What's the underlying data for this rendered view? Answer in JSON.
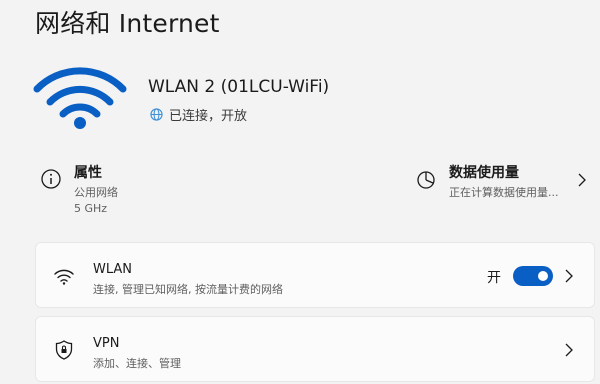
{
  "page": {
    "title": "网络和 Internet"
  },
  "network": {
    "name": "WLAN 2 (01LCU-WiFi)",
    "status": "已连接，开放",
    "icon": "wifi-icon",
    "status_icon": "globe-icon",
    "accent": "#0a5fc4"
  },
  "properties": {
    "title": "属性",
    "line1": "公用网络",
    "line2": "5 GHz",
    "icon": "info-icon"
  },
  "data_usage": {
    "title": "数据使用量",
    "subtitle": "正在计算数据使用量...",
    "icon": "pie-chart-icon"
  },
  "wlan": {
    "title": "WLAN",
    "subtitle": "连接, 管理已知网络, 按流量计费的网络",
    "toggle_label": "开",
    "toggle_on": true,
    "icon": "wifi-icon"
  },
  "vpn": {
    "title": "VPN",
    "subtitle": "添加、连接、管理",
    "icon": "shield-icon"
  }
}
